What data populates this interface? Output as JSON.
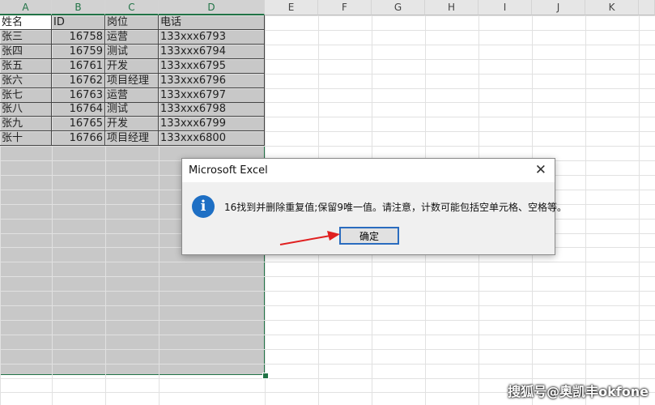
{
  "columns": [
    "A",
    "B",
    "C",
    "D",
    "E",
    "F",
    "G",
    "H",
    "I",
    "J",
    "K"
  ],
  "table": {
    "headers": [
      "姓名",
      "ID",
      "岗位",
      "电话"
    ],
    "rows": [
      [
        "张三",
        "16758",
        "运营",
        "133xxx6793"
      ],
      [
        "张四",
        "16759",
        "测试",
        "133xxx6794"
      ],
      [
        "张五",
        "16761",
        "开发",
        "133xxx6795"
      ],
      [
        "张六",
        "16762",
        "项目经理",
        "133xxx6796"
      ],
      [
        "张七",
        "16763",
        "运营",
        "133xxx6797"
      ],
      [
        "张八",
        "16764",
        "测试",
        "133xxx6798"
      ],
      [
        "张九",
        "16765",
        "开发",
        "133xxx6799"
      ],
      [
        "张十",
        "16766",
        "项目经理",
        "133xxx6800"
      ]
    ]
  },
  "dialog": {
    "title": "Microsoft Excel",
    "message": "16找到并删除重复值;保留9唯一值。请注意，计数可能包括空单元格、空格等。",
    "ok_label": "确定",
    "icon": "info-icon"
  },
  "watermark": "搜狐号@奥凯丰okfone",
  "colors": {
    "accent": "#217346",
    "selection": "#c8c8c8",
    "arrow": "#e02020"
  }
}
